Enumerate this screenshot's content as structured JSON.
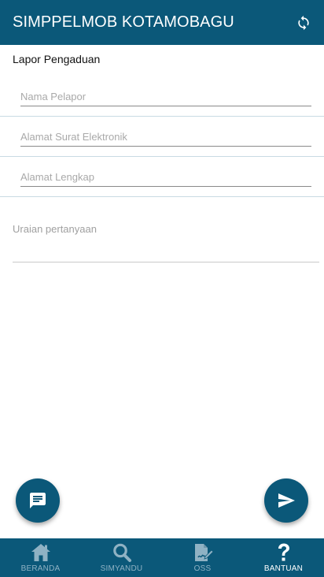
{
  "app": {
    "title": "SIMPPELMOB KOTAMOBAGU"
  },
  "form": {
    "title": "Lapor Pengaduan",
    "fields": [
      {
        "placeholder": "Nama Pelapor",
        "value": ""
      },
      {
        "placeholder": "Alamat Surat Elektronik",
        "value": ""
      },
      {
        "placeholder": "Alamat Lengkap",
        "value": ""
      }
    ],
    "description": {
      "placeholder": "Uraian pertanyaan",
      "value": ""
    }
  },
  "fabs": {
    "chat_icon": "chat-icon",
    "send_icon": "send-icon"
  },
  "nav": {
    "items": [
      {
        "label": "BERANDA",
        "icon": "home-icon",
        "active": false
      },
      {
        "label": "SIMYANDU",
        "icon": "search-icon",
        "active": false
      },
      {
        "label": "OSS",
        "icon": "document-sign-icon",
        "active": false
      },
      {
        "label": "BANTUAN",
        "icon": "help-icon",
        "active": true
      }
    ]
  },
  "colors": {
    "primary": "#0b5879",
    "nav_inactive": "#8fb2c4",
    "nav_active": "#ffffff"
  }
}
